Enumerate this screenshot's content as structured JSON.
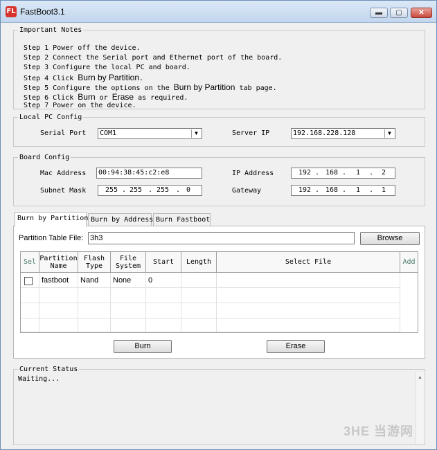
{
  "window": {
    "title": "FastBoot3.1",
    "icon_label": "FL",
    "controls": {
      "minimize": "▬",
      "maximize": "▢",
      "close": "✕"
    }
  },
  "notes": {
    "legend": "Important Notes",
    "steps": [
      {
        "pre": "Step 1 Power off the device.",
        "bold": "",
        "post": ""
      },
      {
        "pre": "Step 2 Connect the Serial port and Ethernet port of the board.",
        "bold": "",
        "post": ""
      },
      {
        "pre": "Step 3 Configure the local PC and board.",
        "bold": "",
        "post": ""
      },
      {
        "pre": "Step 4 Click ",
        "bold": "Burn by Partition",
        "post": "."
      },
      {
        "pre": "Step 5 Configure the options on the ",
        "bold": "Burn by Partition",
        "post": " tab page."
      },
      {
        "pre": "Step 6 Click ",
        "bold": "Burn",
        "post": " or ",
        "bold2": "Erase",
        "post2": " as required."
      },
      {
        "pre": "Step 7 Power on the device.",
        "bold": "",
        "post": ""
      }
    ]
  },
  "local_pc": {
    "legend": "Local PC Config",
    "serial_port_label": "Serial Port",
    "serial_port_value": "COM1",
    "server_ip_label": "Server IP",
    "server_ip_value": "192.168.228.128"
  },
  "board": {
    "legend": "Board Config",
    "mac_label": "Mac Address",
    "mac_value": "00:94:38:45:c2:e8",
    "ip_label": "IP Address",
    "ip_octets": [
      "192",
      "168",
      "1",
      "2"
    ],
    "subnet_label": "Subnet Mask",
    "subnet_octets": [
      "255",
      "255",
      "255",
      "0"
    ],
    "gateway_label": "Gateway",
    "gateway_octets": [
      "192",
      "168",
      "1",
      "1"
    ],
    "dot": "."
  },
  "tabs": [
    {
      "label": "Burn by Partition",
      "active": true
    },
    {
      "label": "Burn by Address",
      "active": false
    },
    {
      "label": "Burn Fastboot",
      "active": false
    }
  ],
  "partition": {
    "table_file_label": "Partition Table File:",
    "table_file_value": "3h3",
    "browse_label": "Browse",
    "columns": {
      "sel": "Sel",
      "name_l1": "Partition",
      "name_l2": "Name",
      "flash_l1": "Flash",
      "flash_l2": "Type",
      "fs_l1": "File",
      "fs_l2": "System",
      "start": "Start",
      "length": "Length",
      "select_file": "Select File",
      "add": "Add"
    },
    "rows": [
      {
        "checked": false,
        "name": "fastboot",
        "flash_type": "Nand",
        "file_system": "None",
        "start": "0",
        "length": "",
        "select_file": ""
      }
    ],
    "burn_label": "Burn",
    "erase_label": "Erase"
  },
  "status": {
    "legend": "Current Status",
    "text": "Waiting..."
  },
  "watermark": "3HE 当游网"
}
